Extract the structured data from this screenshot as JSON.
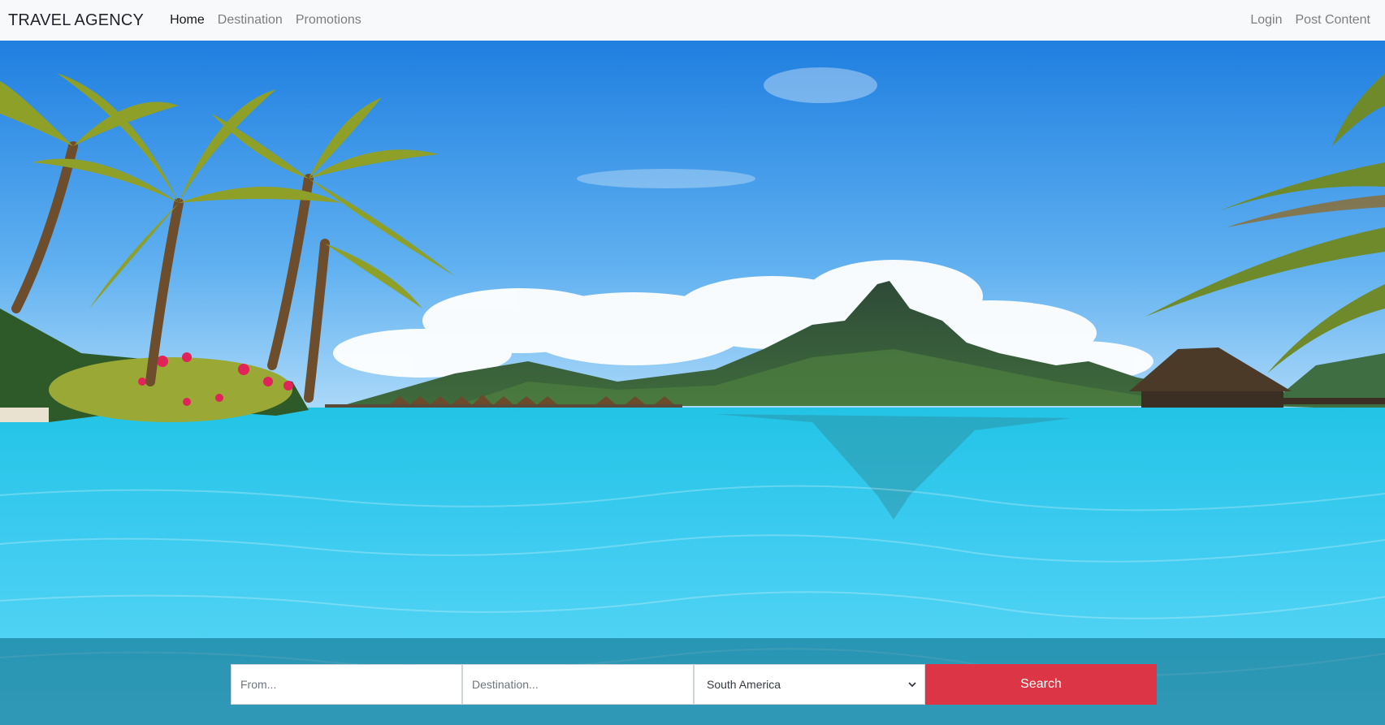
{
  "navbar": {
    "brand": "TRAVEL AGENCY",
    "left_links": [
      "Home",
      "Destination",
      "Promotions"
    ],
    "active": "Home",
    "right_links": [
      "Login",
      "Post Content"
    ]
  },
  "search": {
    "from_placeholder": "From...",
    "destination_placeholder": "Destination...",
    "region_selected": "South America",
    "button_label": "Search"
  },
  "colors": {
    "navbar_bg": "#f8f9fa",
    "search_button": "#dc3545",
    "sky": "#2f8fe0",
    "water": "#3cc8e8"
  },
  "hero": {
    "image": "tropical-lagoon-photo"
  }
}
